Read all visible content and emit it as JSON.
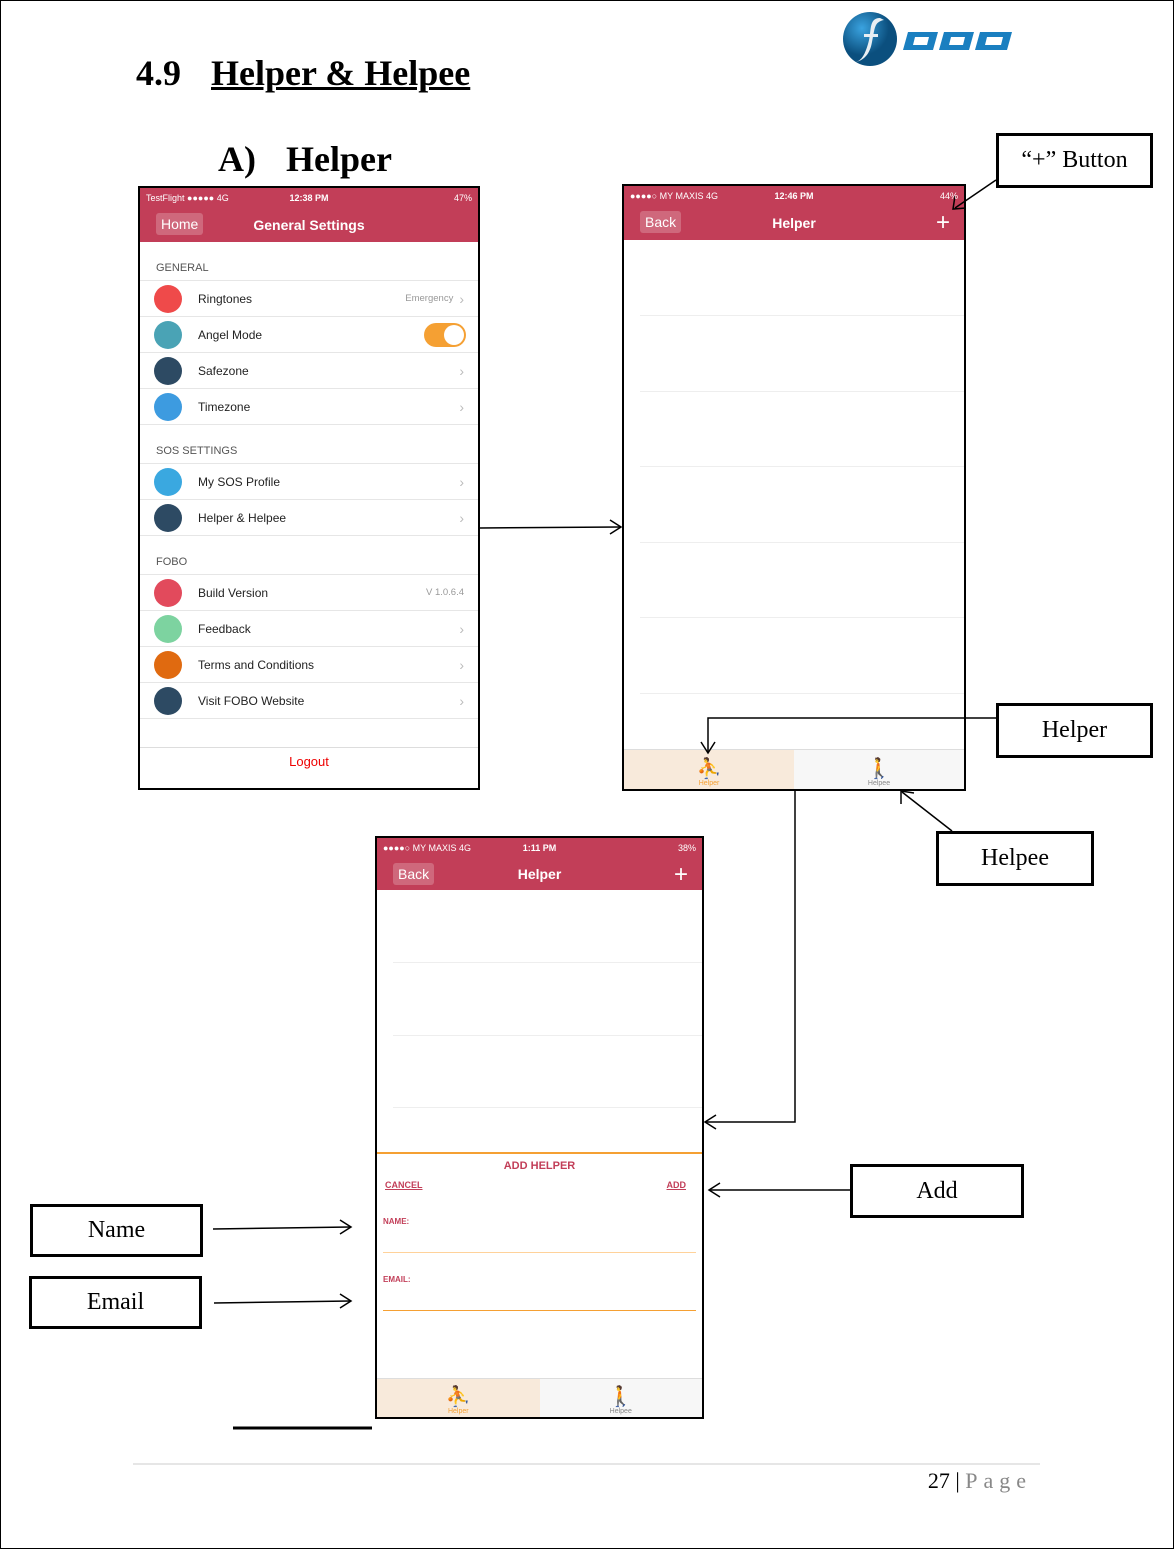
{
  "heading": {
    "number": "4.9",
    "title": "Helper & Helpee"
  },
  "subheading": {
    "number": "A)",
    "title": "Helper"
  },
  "logo": {
    "text": "FOBO",
    "color": "#1a7fc0"
  },
  "colors": {
    "accent": "#c23e58",
    "orange": "#f5a033"
  },
  "screen1": {
    "status": {
      "left": "TestFlight ●●●●● 4G",
      "time": "12:38 PM",
      "right": "47%"
    },
    "nav": {
      "back": "Home",
      "title": "General Settings"
    },
    "sections": [
      {
        "title": "GENERAL",
        "items": [
          {
            "label": "Ringtones",
            "value": "Emergency",
            "icon": "bell-icon",
            "color": "#ef4a4a",
            "type": "chevron"
          },
          {
            "label": "Angel Mode",
            "icon": "angel-icon",
            "color": "#4aa3b5",
            "type": "toggle",
            "on": true
          },
          {
            "label": "Safezone",
            "icon": "globe-pin-icon",
            "color": "#2d4a63",
            "type": "chevron"
          },
          {
            "label": "Timezone",
            "icon": "clock-icon",
            "color": "#3d9be0",
            "type": "chevron"
          }
        ]
      },
      {
        "title": "SOS SETTINGS",
        "items": [
          {
            "label": "My SOS Profile",
            "icon": "siren-icon",
            "color": "#3aa8e0",
            "type": "chevron"
          },
          {
            "label": "Helper & Helpee",
            "icon": "helper-icon",
            "color": "#2d4a63",
            "type": "chevron"
          }
        ]
      },
      {
        "title": "FOBO",
        "items": [
          {
            "label": "Build Version",
            "value": "V 1.0.6.4",
            "icon": "code-icon",
            "color": "#e24a5c",
            "type": "value"
          },
          {
            "label": "Feedback",
            "icon": "chat-icon",
            "color": "#7dd3a0",
            "type": "chevron"
          },
          {
            "label": "Terms and Conditions",
            "icon": "document-icon",
            "color": "#e06a10",
            "type": "chevron"
          },
          {
            "label": "Visit FOBO Website",
            "icon": "browser-icon",
            "color": "#2d4a63",
            "type": "chevron"
          }
        ]
      }
    ],
    "logout": "Logout"
  },
  "screen2": {
    "status": {
      "left": "●●●●○ MY MAXIS 4G",
      "time": "12:46 PM",
      "right": "44%"
    },
    "nav": {
      "back": "Back",
      "title": "Helper",
      "plus": "+"
    },
    "tabs": [
      "Helper",
      "Helpee"
    ]
  },
  "screen3": {
    "status": {
      "left": "●●●●○ MY MAXIS 4G",
      "time": "1:11 PM",
      "right": "38%"
    },
    "nav": {
      "back": "Back",
      "title": "Helper",
      "plus": "+"
    },
    "form": {
      "title": "ADD HELPER",
      "cancel": "CANCEL",
      "add": "ADD",
      "name_label": "NAME:",
      "email_label": "EMAIL:"
    },
    "tabs": [
      "Helper",
      "Helpee"
    ]
  },
  "callouts": {
    "plus": "“+” Button",
    "helper": "Helper",
    "helpee": "Helpee",
    "add": "Add",
    "name": "Name",
    "email": "Email"
  },
  "footer": {
    "page": "27",
    "sep": "|",
    "label": "Page"
  }
}
